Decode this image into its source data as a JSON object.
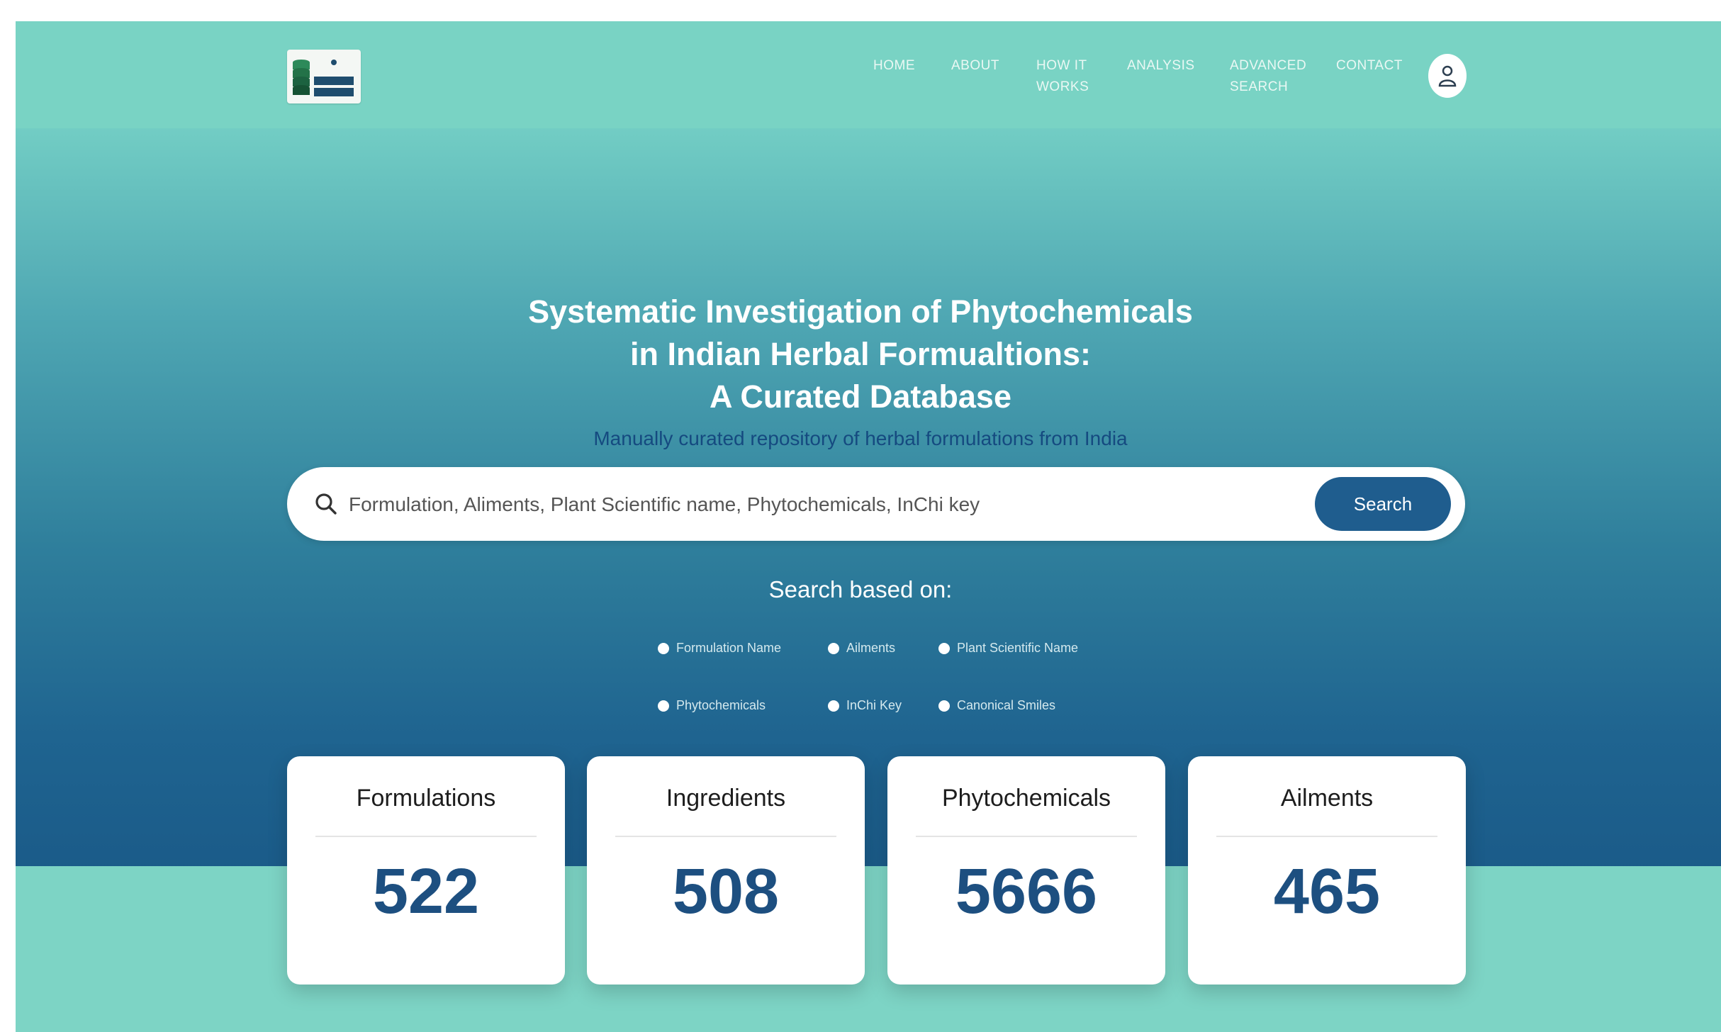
{
  "nav": {
    "items": [
      {
        "label": "HOME"
      },
      {
        "label": "ABOUT"
      },
      {
        "label": "HOW IT WORKS"
      },
      {
        "label": "ANALYSIS"
      },
      {
        "label": "ADVANCED SEARCH"
      },
      {
        "label": "CONTACT"
      }
    ]
  },
  "hero": {
    "title_line1": "Systematic Investigation of Phytochemicals",
    "title_line2": "in Indian Herbal Formualtions:",
    "title_line3": "A Curated Database",
    "subtitle": "Manually curated repository of herbal formulations from India"
  },
  "search": {
    "placeholder": "Formulation, Aliments, Plant Scientific name, Phytochemicals, InChi key",
    "button_label": "Search"
  },
  "search_based_on": {
    "label": "Search based on:",
    "options": [
      {
        "label": "Formulation Name"
      },
      {
        "label": "Ailments"
      },
      {
        "label": "Plant Scientific Name"
      },
      {
        "label": "Phytochemicals"
      },
      {
        "label": "InChi Key"
      },
      {
        "label": "Canonical Smiles"
      }
    ]
  },
  "stats": [
    {
      "label": "Formulations",
      "value": "522"
    },
    {
      "label": "Ingredients",
      "value": "508"
    },
    {
      "label": "Phytochemicals",
      "value": "5666"
    },
    {
      "label": "Ailments",
      "value": "465"
    }
  ],
  "colors": {
    "nav_bg": "#79d3c4",
    "accent": "#1f5d8e",
    "stat_value": "#1d4f80",
    "hero_gradient_top": "#72cdc4",
    "hero_gradient_bottom": "#1a5a88"
  },
  "icons": {
    "logo": "database-logo",
    "search": "search-icon",
    "user": "user-icon"
  }
}
